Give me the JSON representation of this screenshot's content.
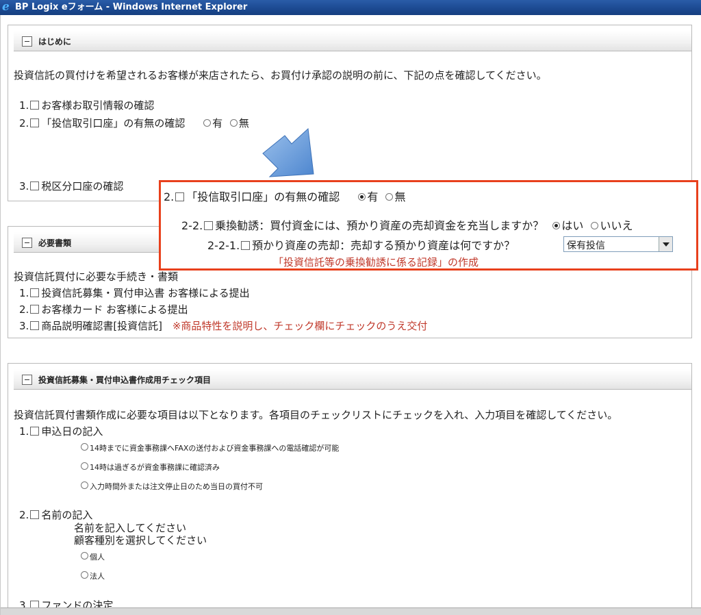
{
  "window": {
    "title": "BP Logix eフォーム - Windows Internet Explorer"
  },
  "section1": {
    "title": "はじめに",
    "intro": "投資信託の買付けを希望されるお客様が来店されたら、お買付け承認の説明の前に、下記の点を確認してください。",
    "item1": {
      "num": "1.",
      "label": "お客様お取引情報の確認"
    },
    "item2": {
      "num": "2.",
      "label": "「投信取引口座」の有無の確認",
      "opt_yes": "有",
      "opt_no": "無"
    },
    "item3": {
      "num": "3.",
      "label": "税区分口座の確認"
    }
  },
  "callout": {
    "line1_num": "2.",
    "line1_label": "「投信取引口座」の有無の確認",
    "line1_yes": "有",
    "line1_no": "無",
    "line2_num": "2-2.",
    "line2_label": "乗換勧誘：買付資金には、預かり資産の売却資金を充当しますか？",
    "line2_yes": "はい",
    "line2_no": "いいえ",
    "line3_num": "2-2-1.",
    "line3_label": "預かり資産の売却：売却する預かり資産は何ですか？",
    "select_value": "保有投信",
    "note": "「投資信託等の乗換勧誘に係る記録」の作成"
  },
  "section2": {
    "title": "必要書類",
    "intro": "投資信託買付に必要な手続き・書類",
    "item1": {
      "num": "1.",
      "label": "投資信託募集・買付申込書 お客様による提出"
    },
    "item2": {
      "num": "2.",
      "label": "お客様カード お客様による提出"
    },
    "item3": {
      "num": "3.",
      "label": "商品説明確認書[投資信託]",
      "note": "※商品特性を説明し、チェック欄にチェックのうえ交付"
    }
  },
  "section3": {
    "title": "投資信託募集・買付申込書作成用チェック項目",
    "intro": "投資信託買付書類作成に必要な項目は以下となります。各項目のチェックリストにチェックを入れ、入力項目を確認してください。",
    "item1": {
      "num": "1.",
      "label": "申込日の記入",
      "options": [
        "14時までに資金事務課へFAXの送付および資金事務課への電話確認が可能",
        "14時は過ぎるが資金事務課に確認済み",
        "入力時間外または注文停止日のため当日の買付不可"
      ]
    },
    "item2": {
      "num": "2.",
      "label": "名前の記入",
      "hint1": "名前を記入してください",
      "hint2": "顧客種別を選択してください",
      "options": [
        "個人",
        "法人"
      ]
    },
    "item3": {
      "num": "3.",
      "label": "ファンドの決定"
    }
  },
  "colors": {
    "callout_border": "#e8401c",
    "note_red": "#c0392b",
    "arrow": "#6a9fd8",
    "titlebar": "#1c4a92"
  }
}
